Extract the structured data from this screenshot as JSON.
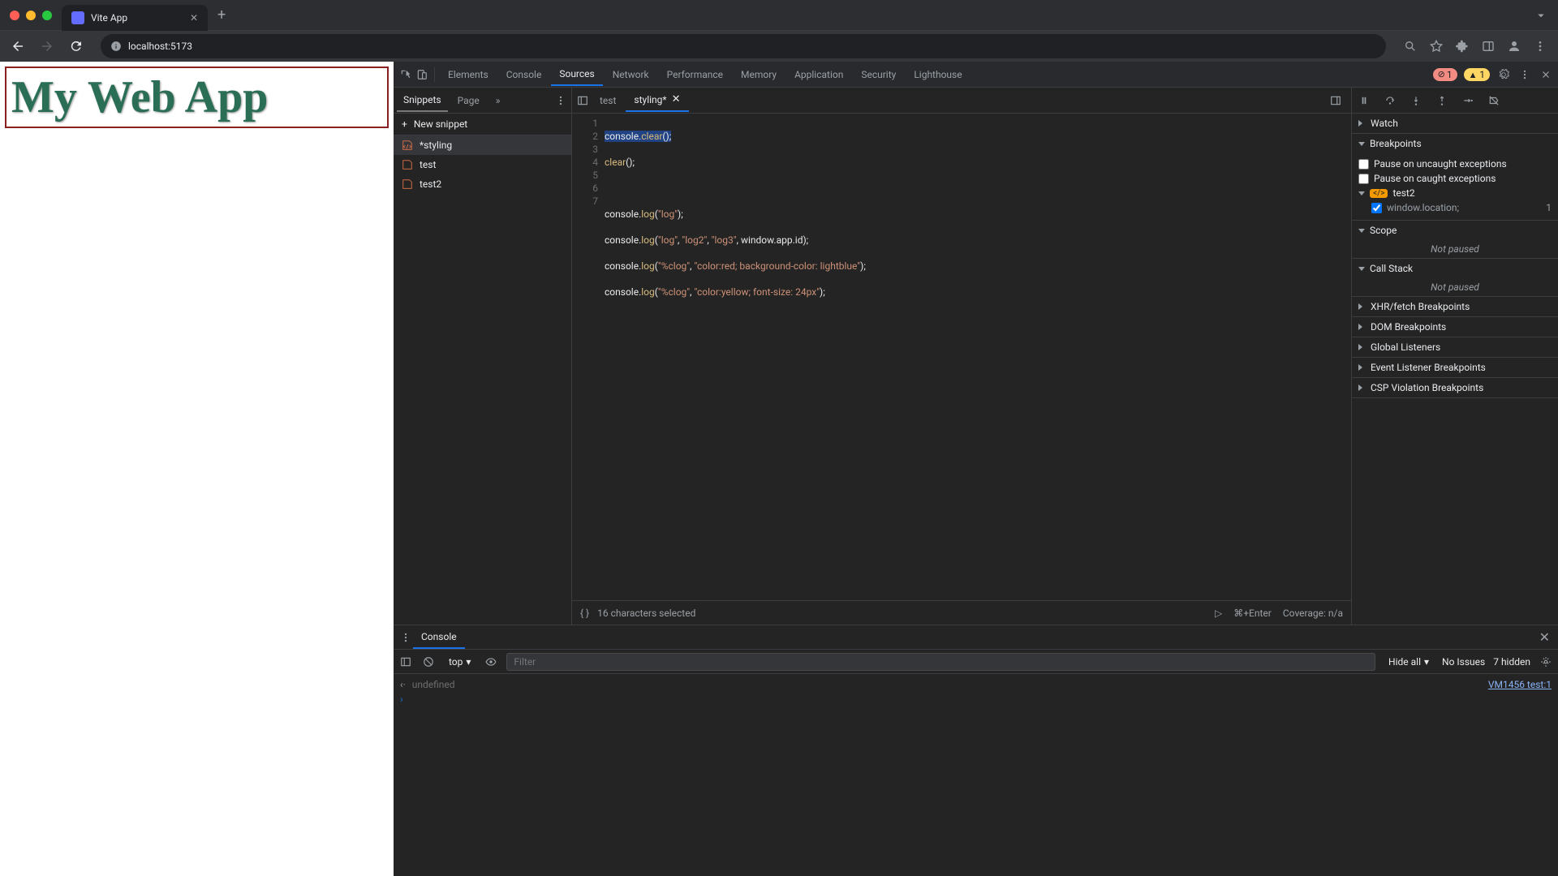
{
  "browser": {
    "tab_title": "Vite App",
    "address": "localhost:5173"
  },
  "page": {
    "heading": "My Web App"
  },
  "devtools": {
    "tabs": [
      "Elements",
      "Console",
      "Sources",
      "Network",
      "Performance",
      "Memory",
      "Application",
      "Security",
      "Lighthouse"
    ],
    "active_tab": "Sources",
    "errors": "1",
    "warnings": "1"
  },
  "sources": {
    "left_tabs": [
      "Snippets",
      "Page"
    ],
    "active_left_tab": "Snippets",
    "new_snippet_label": "New snippet",
    "snippets": [
      "*styling",
      "test",
      "test2"
    ],
    "editor_tabs": [
      "test",
      "styling*"
    ],
    "active_editor_tab": "styling*",
    "code_lines": [
      "console.clear();",
      "clear();",
      "",
      "console.log(\"log\");",
      "console.log(\"log\", \"log2\", \"log3\", window.app.id);",
      "console.log(\"%clog\", \"color:red; background-color: lightblue\");",
      "console.log(\"%clog\", \"color:yellow; font-size: 24px\");"
    ],
    "status_text": "16 characters selected",
    "run_hint": "⌘+Enter",
    "coverage": "Coverage: n/a"
  },
  "debugger": {
    "sections": {
      "watch": "Watch",
      "breakpoints": "Breakpoints",
      "scope": "Scope",
      "callstack": "Call Stack",
      "xhr": "XHR/fetch Breakpoints",
      "dom": "DOM Breakpoints",
      "global": "Global Listeners",
      "event": "Event Listener Breakpoints",
      "csp": "CSP Violation Breakpoints"
    },
    "pause_uncaught": "Pause on uncaught exceptions",
    "pause_caught": "Pause on caught exceptions",
    "bp_file": "test2",
    "bp_code": "window.location;",
    "bp_line": "1",
    "not_paused": "Not paused"
  },
  "console": {
    "drawer_tab": "Console",
    "context": "top",
    "filter_placeholder": "Filter",
    "hide_all": "Hide all",
    "no_issues": "No Issues",
    "hidden": "7 hidden",
    "output_value": "undefined",
    "source_link": "VM1456 test:1"
  }
}
